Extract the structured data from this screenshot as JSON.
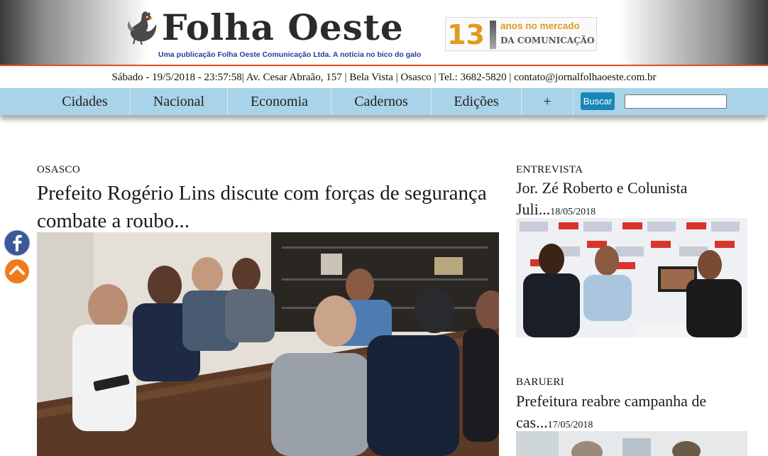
{
  "colors": {
    "nav_bg": "#a9d3e8",
    "accent_orange": "#e0501e",
    "anniv_gold": "#e29b1e",
    "tagline_blue": "#2a3a9a",
    "search_button": "#1a86b8",
    "facebook_blue": "#3b5998"
  },
  "header": {
    "logo_icon": "rooster-icon",
    "title": "Folha Oeste",
    "tagline": "Uma publicação Folha Oeste Comunicação Ltda. A notícia no bico do galo",
    "anniversary": {
      "number": "13",
      "line1": "anos no mercado",
      "line2": "DA COMUNICAÇÃO"
    }
  },
  "infobar": {
    "text": "Sábado - 19/5/2018 - 23:57:58| Av. Cesar Abraão, 157 | Bela Vista | Osasco | Tel.: 3682-5820 | contato@jornalfolhaoeste.com.br"
  },
  "nav": {
    "items": [
      "Cidades",
      "Nacional",
      "Economia",
      "Cadernos",
      "Edições",
      "+"
    ],
    "search_label": "Buscar",
    "search_value": ""
  },
  "main_article": {
    "kicker": "OSASCO",
    "title": "Prefeito Rogério Lins discute com forças de segurança combate a roubo..."
  },
  "side_articles": [
    {
      "kicker": "ENTREVISTA",
      "title": "Jor. Zé Roberto e Colunista Juli...",
      "date": "18/05/2018"
    },
    {
      "kicker": "BARUERI",
      "title": "Prefeitura reabre campanha de cas...",
      "date": "17/05/2018"
    }
  ],
  "floating": {
    "facebook_icon": "facebook-icon",
    "back_to_top_icon": "chevron-up-icon"
  }
}
